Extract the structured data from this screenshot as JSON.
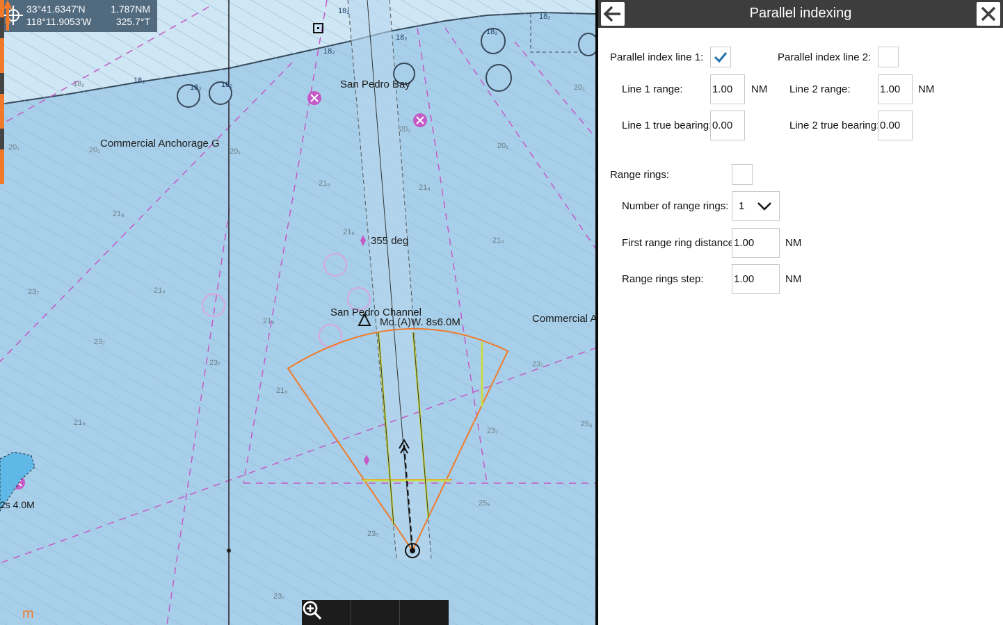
{
  "chart": {
    "coords": {
      "lat": "33°41.6347'N",
      "lon": "118°11.9053'W",
      "distance": "1.787NM",
      "bearing": "325.7°T"
    },
    "labels": {
      "bay": "San Pedro Bay",
      "anchorage_g": "Commercial Anchorage G",
      "anchorage_a": "Commercial A",
      "heading": "355 deg",
      "channel": "San Pedro Channel",
      "light": "Mo.(A)W. 8s6.0M",
      "left_light": "2s 4.0M"
    },
    "depths": [
      {
        "v": "18₂",
        "k": "a"
      },
      {
        "v": "18₂",
        "k": "b"
      },
      {
        "v": "18₂",
        "k": "c"
      },
      {
        "v": "18₂",
        "k": "d"
      },
      {
        "v": "18₂",
        "k": "e"
      },
      {
        "v": "18₂",
        "k": "f"
      },
      {
        "v": "18₂",
        "k": "g"
      },
      {
        "v": "18₂",
        "k": "h"
      },
      {
        "v": "18₂",
        "k": "i"
      },
      {
        "v": "20₁",
        "k": "j"
      },
      {
        "v": "20₁",
        "k": "k"
      },
      {
        "v": "20₁",
        "k": "l"
      },
      {
        "v": "20₁",
        "k": "m"
      },
      {
        "v": "20₁",
        "k": "n"
      },
      {
        "v": "20₁",
        "k": "o"
      },
      {
        "v": "21₉",
        "k": "p"
      },
      {
        "v": "21₉",
        "k": "q"
      },
      {
        "v": "21₉",
        "k": "r"
      },
      {
        "v": "21₉",
        "k": "s"
      },
      {
        "v": "21₉",
        "k": "t"
      },
      {
        "v": "21₉",
        "k": "u"
      },
      {
        "v": "21₉",
        "k": "v"
      },
      {
        "v": "21₉",
        "k": "w"
      },
      {
        "v": "21₉",
        "k": "x"
      },
      {
        "v": "23₇",
        "k": "y"
      },
      {
        "v": "23₇",
        "k": "z"
      },
      {
        "v": "23₇",
        "k": "aa"
      },
      {
        "v": "23₇",
        "k": "ab"
      },
      {
        "v": "23₇",
        "k": "ac"
      },
      {
        "v": "23₇",
        "k": "ad"
      },
      {
        "v": "23₇",
        "k": "ae"
      },
      {
        "v": "25₆",
        "k": "af"
      },
      {
        "v": "25₆",
        "k": "ag"
      }
    ],
    "scale_unit": "m",
    "zoom": {
      "zoom_out": "zoom-out-icon",
      "zoom_fit": "zoom-icon",
      "zoom_in": "zoom-in-icon"
    }
  },
  "panel": {
    "title": "Parallel indexing",
    "line1": {
      "label": "Parallel index line 1:",
      "checked": true,
      "range_label": "Line 1 range:",
      "range_value": "1.00",
      "range_unit": "NM",
      "bearing_label": "Line 1 true bearing:",
      "bearing_value": "0.00"
    },
    "line2": {
      "label": "Parallel index line 2:",
      "checked": false,
      "range_label": "Line 2 range:",
      "range_value": "1.00",
      "range_unit": "NM",
      "bearing_label": "Line 2 true bearing:",
      "bearing_value": "0.00"
    },
    "rings": {
      "label": "Range rings:",
      "checked": false,
      "number_label": "Number of range rings:",
      "number_value": "1",
      "first_label": "First range ring distance:",
      "first_value": "1.00",
      "first_unit": "NM",
      "step_label": "Range rings step:",
      "step_value": "1.00",
      "step_unit": "NM"
    }
  },
  "colors": {
    "water": "#a8cfe9",
    "land": "#cfe6f4",
    "magenta": "#c45ac8",
    "orange": "#f07a2a",
    "index_line": "#c8d94a",
    "header": "#3d3d3d",
    "check": "#1f6fa8"
  }
}
